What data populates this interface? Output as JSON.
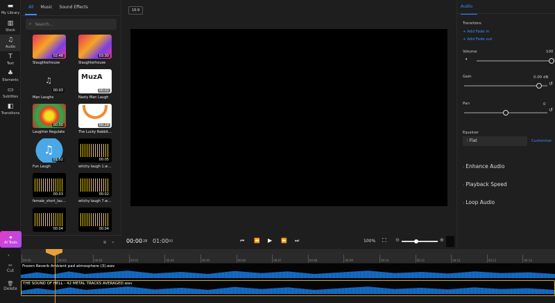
{
  "rail": [
    {
      "label": "My Library",
      "icon": "folder-icon"
    },
    {
      "label": "Stock",
      "icon": "stock-icon"
    },
    {
      "label": "Audio",
      "icon": "music-note-icon"
    },
    {
      "label": "Text",
      "icon": "text-icon"
    },
    {
      "label": "Elements",
      "icon": "shapes-icon"
    },
    {
      "label": "Subtitles",
      "icon": "subtitles-icon"
    },
    {
      "label": "Transitions",
      "icon": "transitions-icon"
    }
  ],
  "ai_tools": "AI Tools",
  "library": {
    "tabs": [
      "All",
      "Music",
      "Sound Effects"
    ],
    "search_placeholder": "Search...",
    "items": [
      {
        "title": "Slaughterhouse",
        "duration": "02:48",
        "style": "art"
      },
      {
        "title": "Slaughterhouse",
        "duration": "03:30",
        "style": "art"
      },
      {
        "title": "Man Laughs",
        "duration": "00:03",
        "style": "note"
      },
      {
        "title": "Nasty Man Laugh",
        "duration": "00:02",
        "style": "muza"
      },
      {
        "title": "Laughter Regulate",
        "duration": "00:00",
        "style": "pattern"
      },
      {
        "title": "The Lucky Rabbit I...",
        "duration": "00:29",
        "style": "rabbit"
      },
      {
        "title": "Fun Laugh",
        "duration": "01:52",
        "style": "blue"
      },
      {
        "title": "witchy laugh 1.wav",
        "duration": "00:05",
        "style": "wave"
      },
      {
        "title": "female_short_laug...",
        "duration": "00:03",
        "style": "wave"
      },
      {
        "title": "witchy laugh 7.wav",
        "duration": "00:02",
        "style": "wave"
      },
      {
        "title": "",
        "duration": "00:04",
        "style": "wave"
      },
      {
        "title": "",
        "duration": "00:04",
        "style": "wave"
      }
    ]
  },
  "preview": {
    "aspect": "16:9",
    "time_current": "00:00",
    "frame_current": "28",
    "time_total": "01:00",
    "frame_total": "00",
    "zoom": "100%",
    "zoom_slider": 0.4
  },
  "right": {
    "tab": "Audio",
    "transitions_label": "Transitions",
    "add_fade_in": "+ Add Fade in",
    "add_fade_out": "+ Add Fade out",
    "volume_label": "Volume",
    "volume_value": "100",
    "volume_level": 1.0,
    "gain_label": "Gain",
    "gain_value": "0.00 dB",
    "gain_level": 0.9,
    "pan_label": "Pan",
    "pan_value": "0",
    "pan_level": 0.5,
    "equalizer_label": "Equalizer",
    "equalizer_value": "Flat",
    "customize": "Customize",
    "sections": [
      "Enhance Audio",
      "Playback Speed",
      "Loop Audio"
    ]
  },
  "timeline": {
    "ticks": [
      "00:00",
      "00:01",
      "00:02",
      "00:03",
      "00:04",
      "00:05",
      "00:06",
      "00:07",
      "00:08",
      "00:09",
      "00:10",
      "00:11",
      "00:12",
      "00:13",
      "00:14"
    ],
    "tools": [
      {
        "label": "Cut",
        "icon": "cut-icon"
      },
      {
        "label": "Delete",
        "icon": "delete-icon"
      }
    ],
    "tracks": [
      "Frozen Reverb Ambient pad atmosphere (3).wav",
      "THE SOUND OF HELL - 42 METAL TRACKS AVERAGED.wav"
    ],
    "accent": "#e8a13a",
    "wave_color": "#1a7fe0"
  }
}
